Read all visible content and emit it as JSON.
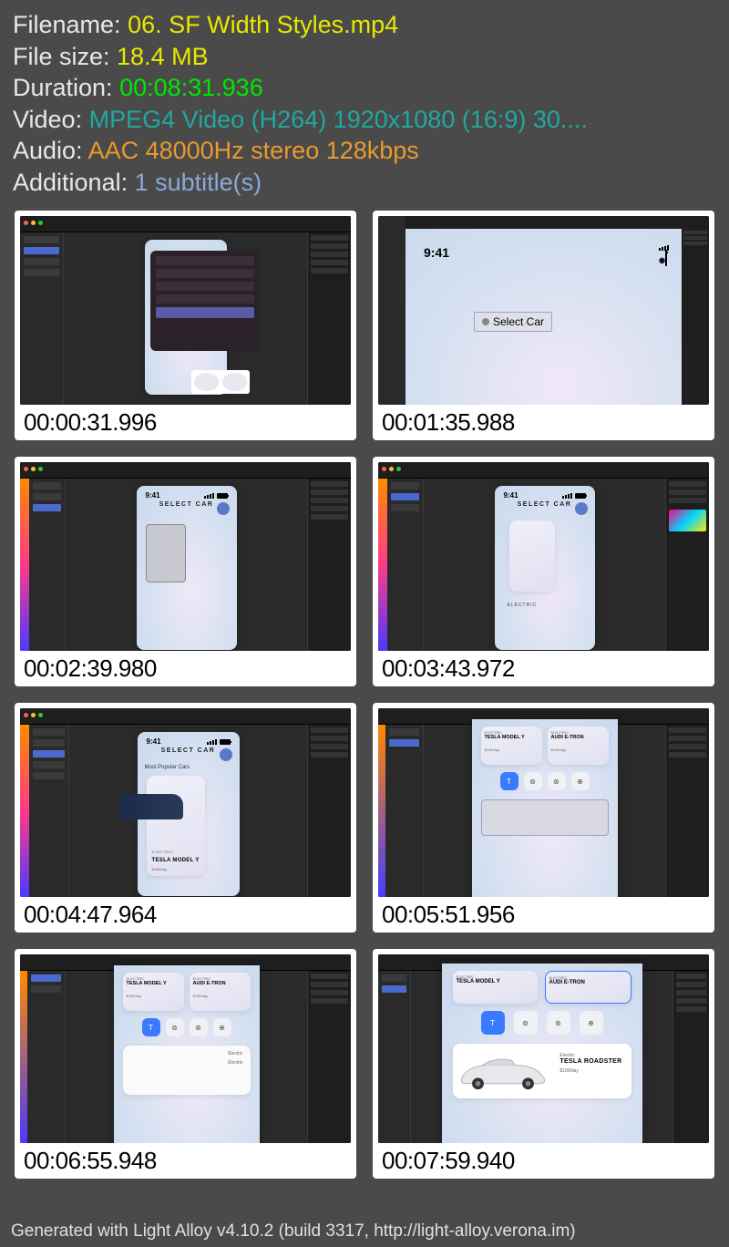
{
  "metadata": {
    "filename_label": "Filename: ",
    "filename": "06. SF Width Styles.mp4",
    "filesize_label": "File size: ",
    "filesize": "18.4 MB",
    "duration_label": "Duration: ",
    "duration": "00:08:31.936",
    "video_label": "Video: ",
    "video": "MPEG4 Video (H264) 1920x1080 (16:9) 30....",
    "audio_label": "Audio: ",
    "audio": "AAC 48000Hz stereo 128kbps",
    "additional_label": "Additional: ",
    "additional": "1 subtitle(s)"
  },
  "thumbs": [
    {
      "ts": "00:00:31.996"
    },
    {
      "ts": "00:01:35.988"
    },
    {
      "ts": "00:02:39.980"
    },
    {
      "ts": "00:03:43.972"
    },
    {
      "ts": "00:04:47.964"
    },
    {
      "ts": "00:05:51.956"
    },
    {
      "ts": "00:06:55.948"
    },
    {
      "ts": "00:07:59.940"
    }
  ],
  "ui": {
    "time": "9:41",
    "select_car_btn": "Select Car",
    "select_car_hdr": "SELECT CAR",
    "most_popular": "Most Popular Cars",
    "electric": "ELECTRIC",
    "electric_lc": "Electric",
    "model_y": "TESLA MODEL Y",
    "etron": "AUDI E-TRON",
    "roadster": "TESLA ROADSTER",
    "price": "$190/day",
    "brand_t": "T",
    "brand_audi": "⊚",
    "brand_bmw": "⊛",
    "brand_mb": "⊕"
  },
  "footer": "Generated with Light Alloy v4.10.2 (build 3317, http://light-alloy.verona.im)"
}
